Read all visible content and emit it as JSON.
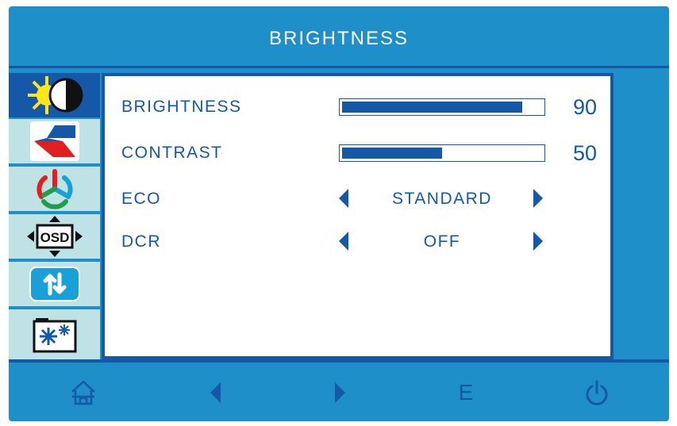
{
  "title": "BRIGHTNESS",
  "sidebar": {
    "tabs": [
      {
        "icon": "brightness-icon",
        "active": true
      },
      {
        "icon": "image-icon",
        "active": false
      },
      {
        "icon": "color-icon",
        "active": false
      },
      {
        "icon": "osd-icon",
        "icon_text": "OSD",
        "active": false
      },
      {
        "icon": "reset-icon",
        "active": false
      },
      {
        "icon": "misc-settings-icon",
        "active": false
      }
    ]
  },
  "rows": {
    "brightness": {
      "label": "BRIGHTNESS",
      "value": "90",
      "level": 90
    },
    "contrast": {
      "label": "CONTRAST",
      "value": "50",
      "level": 50
    },
    "eco": {
      "label": "ECO",
      "value": "STANDARD"
    },
    "dcr": {
      "label": "DCR",
      "value": "OFF"
    }
  },
  "footer": {
    "buttons": [
      {
        "icon": "home-icon"
      },
      {
        "icon": "left-arrow-icon"
      },
      {
        "icon": "right-arrow-icon"
      },
      {
        "icon": "e-button-icon",
        "text": "E"
      },
      {
        "icon": "power-icon"
      }
    ]
  },
  "colors": {
    "frame": "#1e8fc9",
    "accent": "#1558a8",
    "tab": "#bfe2e4",
    "panel": "#ffffff"
  }
}
